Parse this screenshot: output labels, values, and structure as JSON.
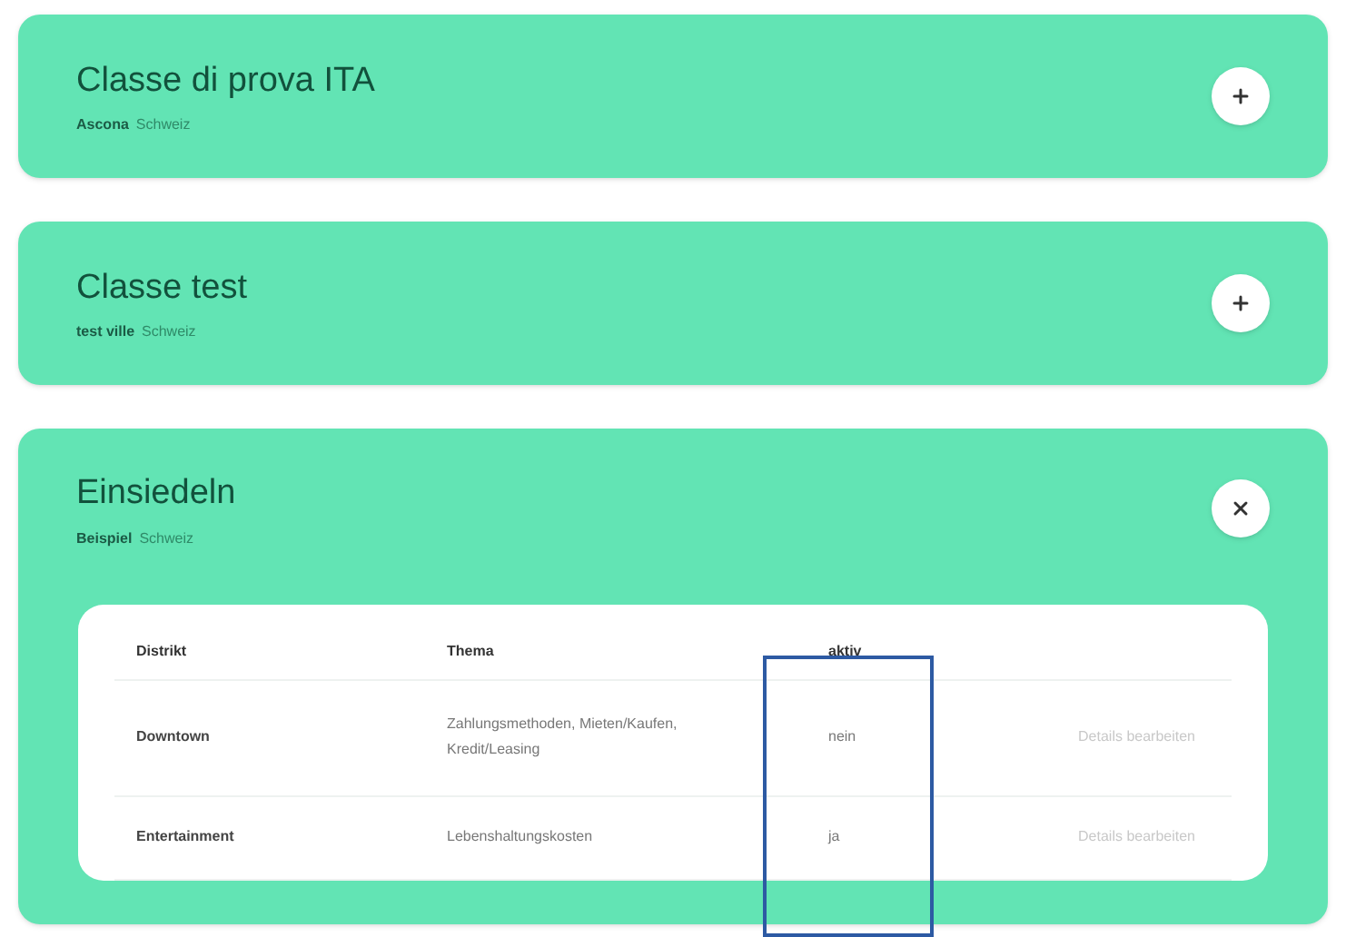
{
  "classes": [
    {
      "title": "Classe di prova ITA",
      "subtitle": "Ascona",
      "meta": "Schweiz",
      "expanded": false
    },
    {
      "title": "Classe test",
      "subtitle": "test ville",
      "meta": "Schweiz",
      "expanded": false
    },
    {
      "title": "Einsiedeln",
      "subtitle": "Beispiel",
      "meta": "Schweiz",
      "expanded": true,
      "table": {
        "columns": [
          "Distrikt",
          "Thema",
          "aktiv"
        ],
        "rows": [
          {
            "district": "Downtown",
            "topic": "Zahlungsmethoden, Mieten/Kaufen, Kredit/Leasing",
            "active": "nein",
            "action": "Details bearbeiten"
          },
          {
            "district": "Entertainment",
            "topic": "Lebenshaltungskosten",
            "active": "ja",
            "action": "Details bearbeiten"
          }
        ]
      }
    }
  ]
}
